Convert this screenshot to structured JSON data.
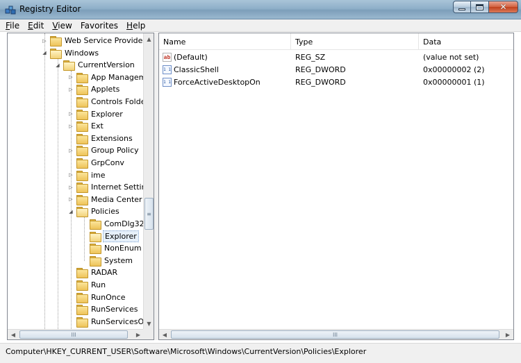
{
  "window": {
    "title": "Registry Editor",
    "close_glyph": "✕"
  },
  "menu": [
    {
      "key": "F",
      "rest": "ile"
    },
    {
      "key": "E",
      "rest": "dit"
    },
    {
      "key": "V",
      "rest": "iew"
    },
    {
      "key": "",
      "rest": "Favorites"
    },
    {
      "key": "H",
      "rest": "elp"
    }
  ],
  "tree": {
    "items": [
      {
        "label": "Web Service Providers",
        "expander": "▷",
        "open": false
      },
      {
        "label": "Windows",
        "expander": "◢",
        "open": true
      },
      {
        "label": "CurrentVersion",
        "expander": "◢",
        "open": true
      },
      {
        "label": "App Managem",
        "expander": "▷",
        "open": false
      },
      {
        "label": "Applets",
        "expander": "▷",
        "open": false
      },
      {
        "label": "Controls Folde",
        "expander": "",
        "open": false
      },
      {
        "label": "Explorer",
        "expander": "▷",
        "open": false
      },
      {
        "label": "Ext",
        "expander": "▷",
        "open": false
      },
      {
        "label": "Extensions",
        "expander": "",
        "open": false
      },
      {
        "label": "Group Policy",
        "expander": "▷",
        "open": false
      },
      {
        "label": "GrpConv",
        "expander": "",
        "open": false
      },
      {
        "label": "ime",
        "expander": "▷",
        "open": false
      },
      {
        "label": "Internet Settin",
        "expander": "▷",
        "open": false
      },
      {
        "label": "Media Center",
        "expander": "▷",
        "open": false
      },
      {
        "label": "Policies",
        "expander": "◢",
        "open": true
      },
      {
        "label": "ComDlg32",
        "expander": "",
        "open": false
      },
      {
        "label": "Explorer",
        "expander": "",
        "open": true,
        "selected": true
      },
      {
        "label": "NonEnum",
        "expander": "",
        "open": false
      },
      {
        "label": "System",
        "expander": "",
        "open": false
      },
      {
        "label": "RADAR",
        "expander": "",
        "open": false
      },
      {
        "label": "Run",
        "expander": "",
        "open": false
      },
      {
        "label": "RunOnce",
        "expander": "",
        "open": false
      },
      {
        "label": "RunServices",
        "expander": "",
        "open": false
      },
      {
        "label": "RunServicesOr",
        "expander": "",
        "open": false
      }
    ],
    "scroll": {
      "up": "▲",
      "down": "▼",
      "left": "◀",
      "right": "▶",
      "grip_v": "≡",
      "grip_h": "III"
    }
  },
  "list": {
    "columns": {
      "name": "Name",
      "type": "Type",
      "data": "Data"
    },
    "rows": [
      {
        "icon": "string-value-icon",
        "icon_text": "ab",
        "name": "(Default)",
        "type": "REG_SZ",
        "data": "(value not set)"
      },
      {
        "icon": "dword-value-icon",
        "icon_text": "011\n110",
        "name": "ClassicShell",
        "type": "REG_DWORD",
        "data": "0x00000002 (2)"
      },
      {
        "icon": "dword-value-icon",
        "icon_text": "011\n110",
        "name": "ForceActiveDesktopOn",
        "type": "REG_DWORD",
        "data": "0x00000001 (1)"
      }
    ]
  },
  "statusbar": {
    "path": "Computer\\HKEY_CURRENT_USER\\Software\\Microsoft\\Windows\\CurrentVersion\\Policies\\Explorer"
  }
}
